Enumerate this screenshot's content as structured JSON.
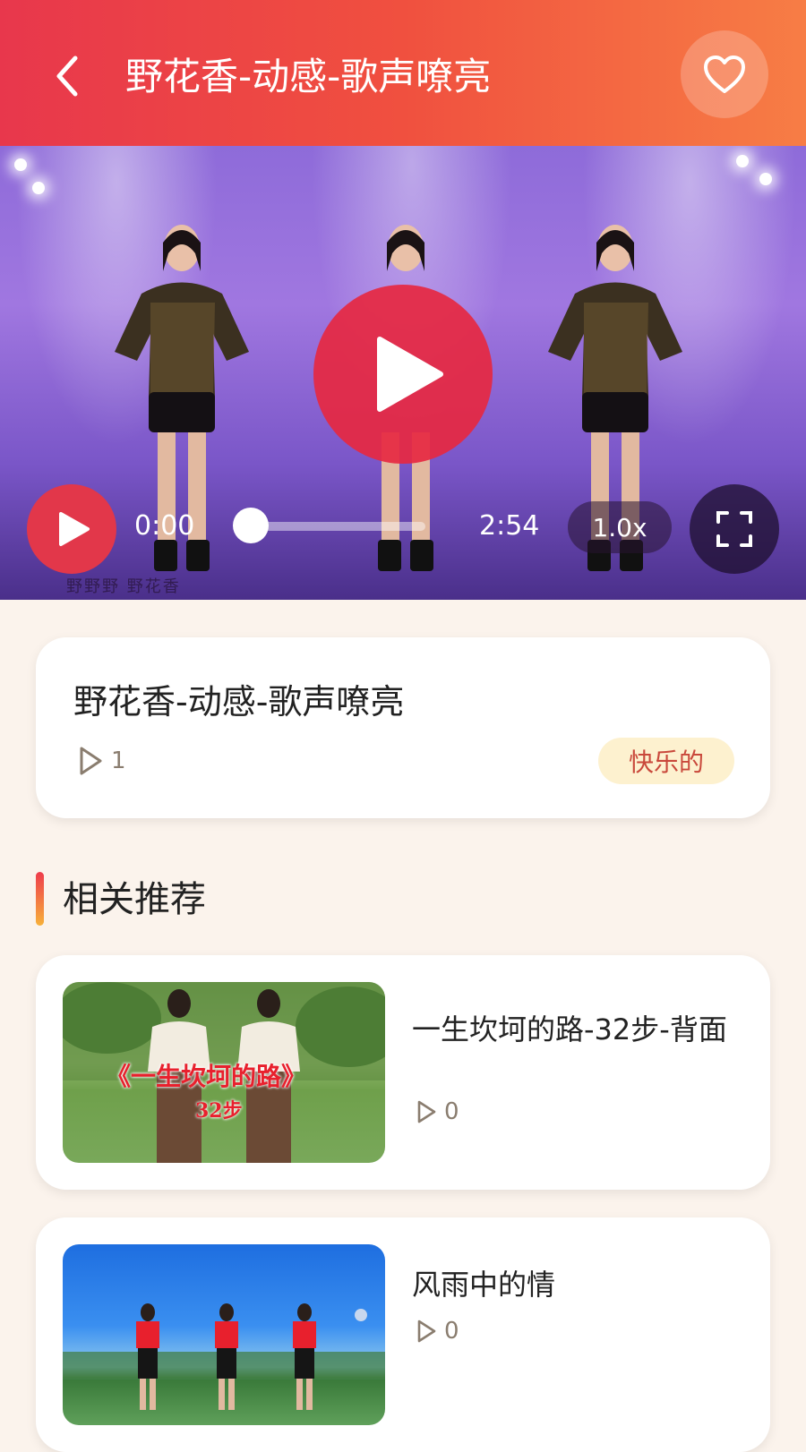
{
  "header": {
    "title": "野花香-动感-歌声嘹亮",
    "back_icon": "chevron-left-icon",
    "favorite_icon": "heart-icon"
  },
  "player": {
    "current_time": "0:00",
    "total_time": "2:54",
    "speed": "1.0x",
    "progress": 0,
    "watermark": "野野野  野花香",
    "accent_color": "#e2374a"
  },
  "info": {
    "title": "野花香-动感-歌声嘹亮",
    "play_count": "1",
    "mood_tag": "快乐的"
  },
  "section": {
    "title": "相关推荐"
  },
  "recommendations": [
    {
      "title": "一生坎坷的路-32步-背面",
      "play_count": "0",
      "thumb_caption": "《一生坎坷的路》",
      "thumb_subcaption": "32步"
    },
    {
      "title": "风雨中的情",
      "play_count": "0"
    }
  ]
}
